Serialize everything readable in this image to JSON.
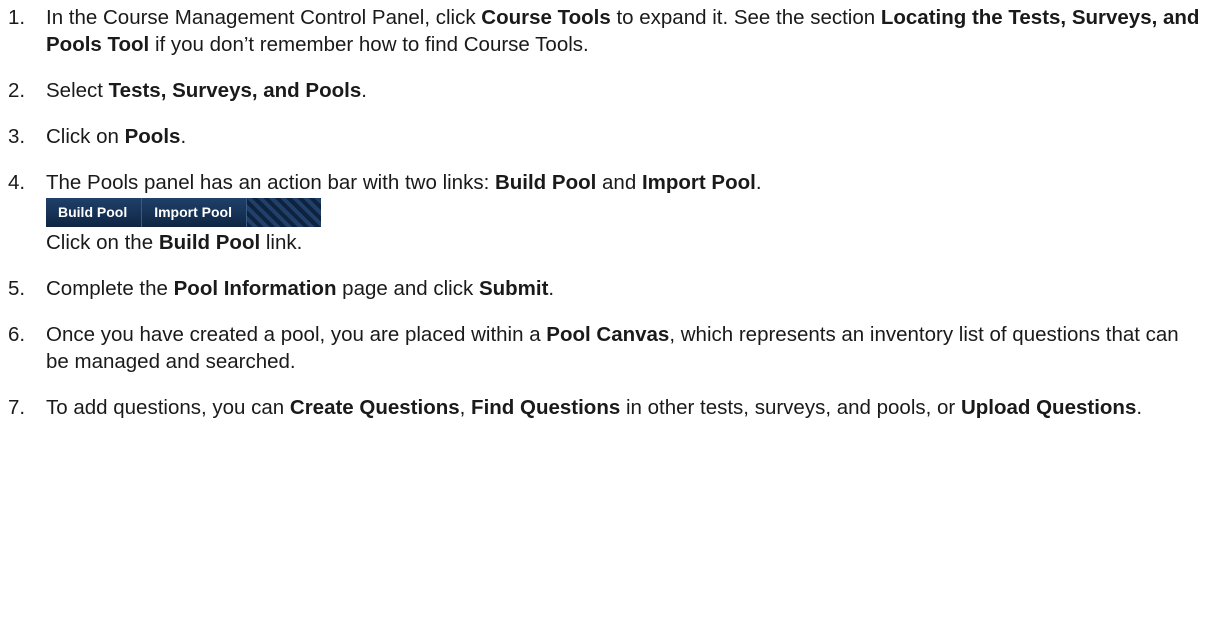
{
  "steps": [
    {
      "num": "1.",
      "p1": "In the Course Management Control Panel, click ",
      "b1": "Course Tools",
      "p2": " to expand it.  See the section ",
      "b2": "Locating the Tests, Surveys, and Pools Tool",
      "p3": " if you don’t remember how to find Course Tools."
    },
    {
      "num": "2.",
      "p1": "Select ",
      "b1": "Tests, Surveys, and Pools",
      "p2": "."
    },
    {
      "num": "3.",
      "p1": "Click on ",
      "b1": "Pools",
      "p2": "."
    },
    {
      "num": "4.",
      "p1": "The Pools panel has an action bar with two links:  ",
      "b1": "Build Pool",
      "p2": " and ",
      "b2": "Import Pool",
      "p3": ".",
      "p4": "Click on the ",
      "b3": "Build Pool",
      "p5": " link."
    },
    {
      "num": "5.",
      "p1": "Complete the ",
      "b1": "Pool Information",
      "p2": " page and click ",
      "b2": "Submit",
      "p3": "."
    },
    {
      "num": "6.",
      "p1": "Once you have created a pool, you are placed within a ",
      "b1": "Pool Canvas",
      "p2": ", which represents an inventory list of questions that can be managed and searched."
    },
    {
      "num": "7.",
      "p1": "To add questions, you can ",
      "b1": "Create Questions",
      "p2": ", ",
      "b2": "Find Questions",
      "p3": " in other tests, surveys, and pools, or ",
      "b3": "Upload Questions",
      "p4": "."
    }
  ],
  "action_bar": {
    "build_pool_label": "Build Pool",
    "import_pool_label": "Import Pool"
  }
}
